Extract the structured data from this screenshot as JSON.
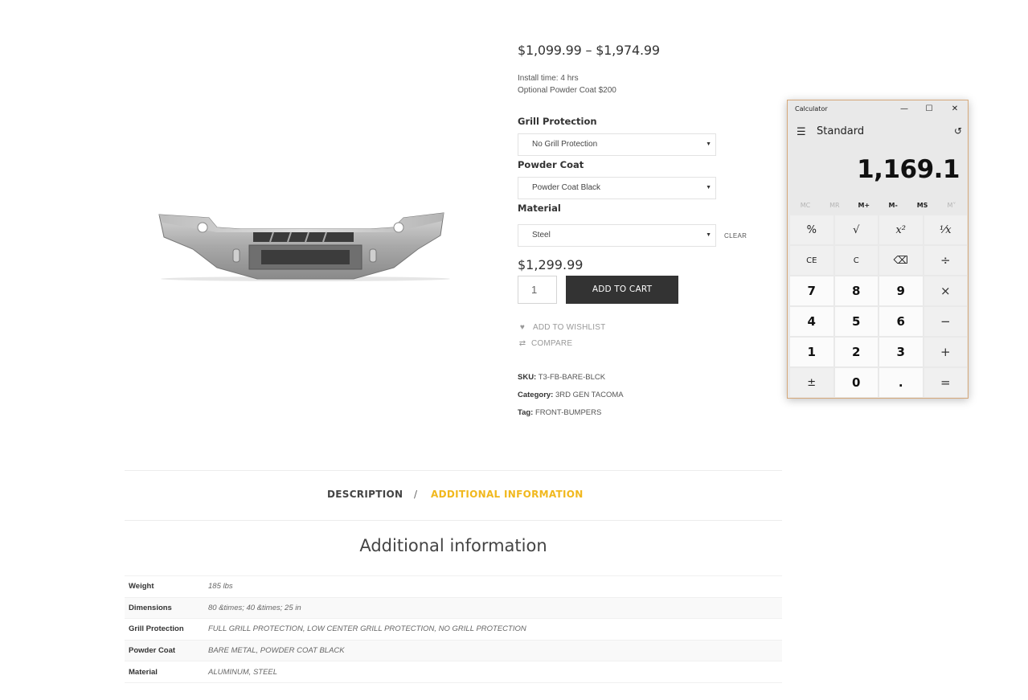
{
  "product": {
    "price_range": "$1,099.99 – $1,974.99",
    "install_time": "Install time: 4 hrs",
    "powder_coat_note": "Optional Powder Coat $200",
    "variations": [
      {
        "label": "Grill Protection",
        "selected": "No Grill Protection"
      },
      {
        "label": "Powder Coat",
        "selected": "Powder Coat Black"
      },
      {
        "label": "Material",
        "selected": "Steel"
      }
    ],
    "clear_label": "CLEAR",
    "variation_price": "$1,299.99",
    "quantity": "1",
    "add_to_cart": "ADD TO CART",
    "wishlist": "ADD TO WISHLIST",
    "compare": "COMPARE",
    "sku_label": "SKU:",
    "sku": "T3-FB-BARE-BLCK",
    "category_label": "Category:",
    "category": "3RD GEN TACOMA",
    "tag_label": "Tag:",
    "tag": "FRONT-BUMPERS"
  },
  "tabs": {
    "description": "DESCRIPTION",
    "separator": "/",
    "additional": "ADDITIONAL INFORMATION",
    "active_color": "#f1b81d"
  },
  "additional_info": {
    "title": "Additional information",
    "rows": [
      {
        "label": "Weight",
        "value": "185 lbs"
      },
      {
        "label": "Dimensions",
        "value": "80 &times; 40 &times; 25 in"
      },
      {
        "label": "Grill Protection",
        "value": "FULL GRILL PROTECTION, LOW CENTER GRILL PROTECTION, NO GRILL PROTECTION"
      },
      {
        "label": "Powder Coat",
        "value": "BARE METAL, POWDER COAT BLACK"
      },
      {
        "label": "Material",
        "value": "ALUMINUM, STEEL"
      }
    ]
  },
  "calculator": {
    "window_title": "Calculator",
    "mode": "Standard",
    "display": "1,169.1",
    "memory": [
      "MC",
      "MR",
      "M+",
      "M-",
      "MS",
      "M˅"
    ],
    "keys": [
      "%",
      "√",
      "x²",
      "¹⁄x",
      "CE",
      "C",
      "⌫",
      "÷",
      "7",
      "8",
      "9",
      "×",
      "4",
      "5",
      "6",
      "−",
      "1",
      "2",
      "3",
      "+",
      "±",
      "0",
      ".",
      "="
    ]
  }
}
